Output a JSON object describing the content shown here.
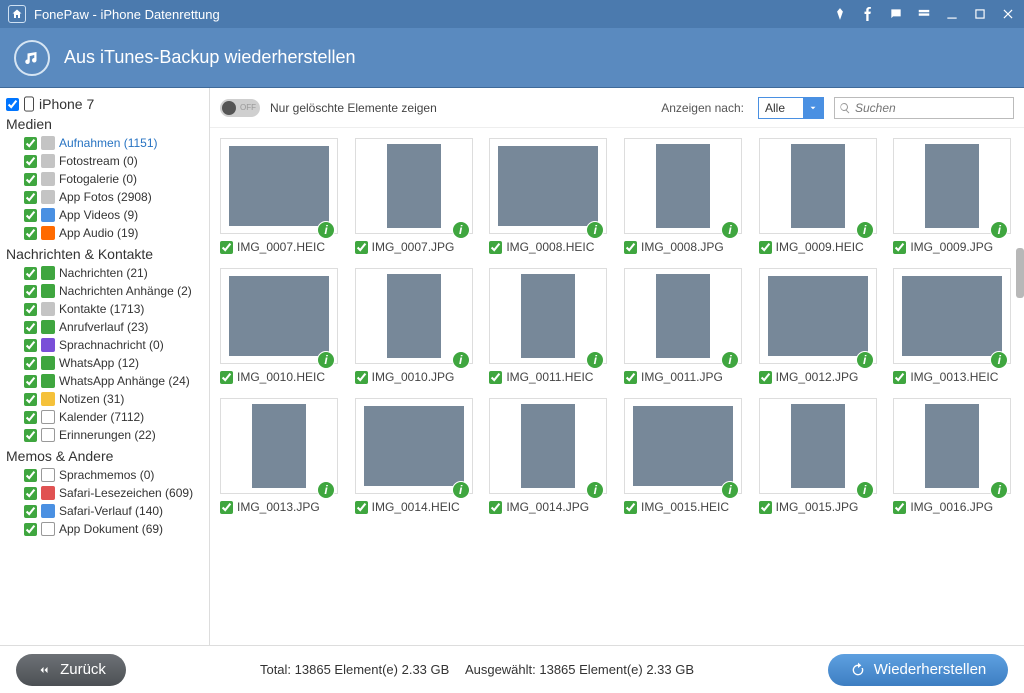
{
  "titlebar": {
    "title": "FonePaw - iPhone Datenrettung"
  },
  "subheader": {
    "title": "Aus iTunes-Backup wiederherstellen"
  },
  "sidebar": {
    "device_name": "iPhone 7",
    "sections": {
      "media": {
        "label": "Medien",
        "items": [
          {
            "label": "Aufnahmen (1151)",
            "icon": "gray",
            "active": true
          },
          {
            "label": "Fotostream (0)",
            "icon": "gray"
          },
          {
            "label": "Fotogalerie (0)",
            "icon": "gray"
          },
          {
            "label": "App Fotos (2908)",
            "icon": "gray"
          },
          {
            "label": "App Videos (9)",
            "icon": "blue"
          },
          {
            "label": "App Audio (19)",
            "icon": "orange"
          }
        ]
      },
      "messages": {
        "label": "Nachrichten & Kontakte",
        "items": [
          {
            "label": "Nachrichten (21)",
            "icon": "green"
          },
          {
            "label": "Nachrichten Anhänge (2)",
            "icon": "green"
          },
          {
            "label": "Kontakte (1713)",
            "icon": "gray"
          },
          {
            "label": "Anrufverlauf (23)",
            "icon": "green"
          },
          {
            "label": "Sprachnachricht (0)",
            "icon": "purple"
          },
          {
            "label": "WhatsApp (12)",
            "icon": "green"
          },
          {
            "label": "WhatsApp Anhänge (24)",
            "icon": "green"
          },
          {
            "label": "Notizen (31)",
            "icon": "yellow"
          },
          {
            "label": "Kalender (7112)",
            "icon": "white"
          },
          {
            "label": "Erinnerungen (22)",
            "icon": "white"
          }
        ]
      },
      "memos": {
        "label": "Memos & Andere",
        "items": [
          {
            "label": "Sprachmemos (0)",
            "icon": "white"
          },
          {
            "label": "Safari-Lesezeichen (609)",
            "icon": "red"
          },
          {
            "label": "Safari-Verlauf (140)",
            "icon": "blue"
          },
          {
            "label": "App Dokument (69)",
            "icon": "white"
          }
        ]
      }
    }
  },
  "toolbar": {
    "toggle_text": "OFF",
    "toggle_label": "Nur gelöschte Elemente zeigen",
    "show_label": "Anzeigen nach:",
    "filter_value": "Alle",
    "search_placeholder": "Suchen"
  },
  "grid": [
    {
      "name": "IMG_0007.HEIC",
      "cls": "t1",
      "portrait": false
    },
    {
      "name": "IMG_0007.JPG",
      "cls": "t2",
      "portrait": true
    },
    {
      "name": "IMG_0008.HEIC",
      "cls": "t3",
      "portrait": false
    },
    {
      "name": "IMG_0008.JPG",
      "cls": "t4",
      "portrait": true
    },
    {
      "name": "IMG_0009.HEIC",
      "cls": "t5",
      "portrait": true
    },
    {
      "name": "IMG_0009.JPG",
      "cls": "t6",
      "portrait": true
    },
    {
      "name": "IMG_0010.HEIC",
      "cls": "t7",
      "portrait": false
    },
    {
      "name": "IMG_0010.JPG",
      "cls": "t8",
      "portrait": true
    },
    {
      "name": "IMG_0011.HEIC",
      "cls": "t9",
      "portrait": true
    },
    {
      "name": "IMG_0011.JPG",
      "cls": "t10",
      "portrait": true
    },
    {
      "name": "IMG_0012.JPG",
      "cls": "t11",
      "portrait": false
    },
    {
      "name": "IMG_0013.HEIC",
      "cls": "t12",
      "portrait": false
    },
    {
      "name": "IMG_0013.JPG",
      "cls": "t13",
      "portrait": true
    },
    {
      "name": "IMG_0014.HEIC",
      "cls": "t14",
      "portrait": false
    },
    {
      "name": "IMG_0014.JPG",
      "cls": "t15",
      "portrait": true
    },
    {
      "name": "IMG_0015.HEIC",
      "cls": "t16",
      "portrait": false
    },
    {
      "name": "IMG_0015.JPG",
      "cls": "t17",
      "portrait": true
    },
    {
      "name": "IMG_0016.JPG",
      "cls": "t18",
      "portrait": true
    }
  ],
  "footer": {
    "back_label": "Zurück",
    "total_label": "Total: 13865 Element(e) 2.33 GB",
    "selected_label": "Ausgewählt: 13865 Element(e) 2.33 GB",
    "recover_label": "Wiederherstellen"
  }
}
